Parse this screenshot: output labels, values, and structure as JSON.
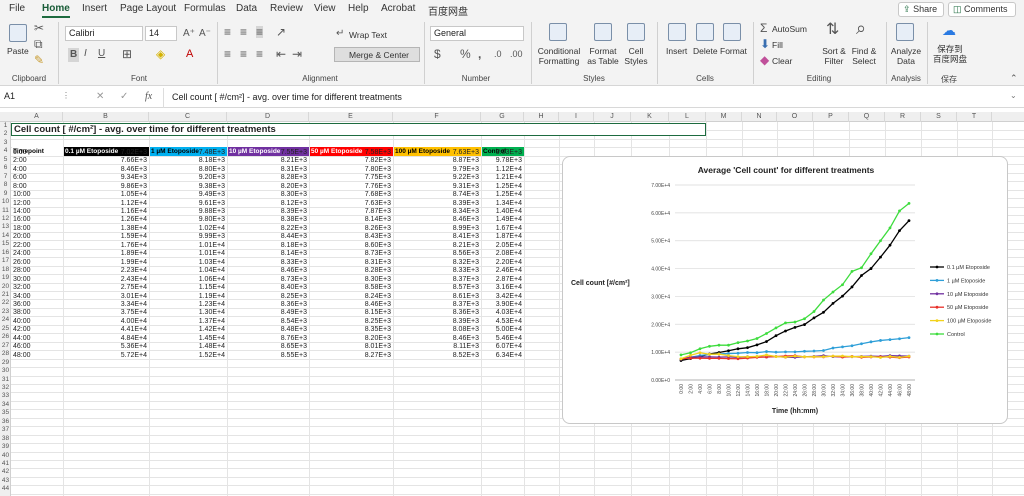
{
  "menu": {
    "tabs": [
      "File",
      "Home",
      "Insert",
      "Page Layout",
      "Formulas",
      "Data",
      "Review",
      "View",
      "Help",
      "Acrobat",
      "百度网盘"
    ],
    "active": "Home",
    "share": "Share",
    "comments": "Comments"
  },
  "ribbon": {
    "clipboard": {
      "paste": "Paste",
      "label": "Clipboard"
    },
    "font": {
      "name": "Calibri",
      "size": "14",
      "label": "Font"
    },
    "alignment": {
      "wrap": "Wrap Text",
      "merge": "Merge & Center",
      "label": "Alignment"
    },
    "number": {
      "format": "General",
      "label": "Number"
    },
    "styles": {
      "conditional": "Conditional Formatting",
      "format_table": "Format as Table",
      "cell_styles": "Cell Styles",
      "label": "Styles"
    },
    "cells": {
      "insert": "Insert",
      "delete": "Delete",
      "format": "Format",
      "label": "Cells"
    },
    "editing": {
      "autosum": "AutoSum",
      "fill": "Fill",
      "clear": "Clear",
      "sort": "Sort & Filter",
      "find": "Find & Select",
      "label": "Editing"
    },
    "analysis": {
      "analyze": "Analyze Data",
      "label": "Analysis"
    },
    "save": {
      "button": "保存到 百度网盘",
      "label": "保存"
    }
  },
  "formula_bar": {
    "name_box": "A1",
    "fx": "fx",
    "content": "Cell count [ #/cm²] - avg. over time for different treatments"
  },
  "columns": [
    "A",
    "B",
    "C",
    "D",
    "E",
    "F",
    "G",
    "H",
    "I",
    "J",
    "K",
    "L",
    "M",
    "N",
    "O",
    "P",
    "Q",
    "R",
    "S",
    "T"
  ],
  "sheet": {
    "title": "Cell count [ #/cm²] - avg. over time for different treatments",
    "headers": [
      "Timepoint",
      "0.1 µM Etoposide",
      "1 µM Etoposide",
      "10 µM Etoposide",
      "50 µM Etoposide",
      "100 µM Etoposide",
      "Control"
    ],
    "header_colors": [
      "#ffffff",
      "#000000",
      "#00b0f0",
      "#7030a0",
      "#ff0000",
      "#ffc000",
      "#00b050"
    ],
    "rows": [
      [
        "0:00",
        "7.02E+3",
        "7.48E+3",
        "7.55E+3",
        "7.58E+3",
        "7.63E+3",
        "9.03E+3"
      ],
      [
        "2:00",
        "7.66E+3",
        "8.18E+3",
        "8.21E+3",
        "7.82E+3",
        "8.87E+3",
        "9.78E+3"
      ],
      [
        "4:00",
        "8.46E+3",
        "8.80E+3",
        "8.31E+3",
        "7.80E+3",
        "9.79E+3",
        "1.12E+4"
      ],
      [
        "6:00",
        "9.34E+3",
        "9.20E+3",
        "8.28E+3",
        "7.75E+3",
        "9.22E+3",
        "1.21E+4"
      ],
      [
        "8:00",
        "9.86E+3",
        "9.38E+3",
        "8.20E+3",
        "7.76E+3",
        "9.31E+3",
        "1.25E+4"
      ],
      [
        "10:00",
        "1.05E+4",
        "9.49E+3",
        "8.30E+3",
        "7.68E+3",
        "8.74E+3",
        "1.25E+4"
      ],
      [
        "12:00",
        "1.12E+4",
        "9.61E+3",
        "8.12E+3",
        "7.63E+3",
        "8.39E+3",
        "1.34E+4"
      ],
      [
        "14:00",
        "1.16E+4",
        "9.88E+3",
        "8.39E+3",
        "7.87E+3",
        "8.34E+3",
        "1.40E+4"
      ],
      [
        "16:00",
        "1.26E+4",
        "9.80E+3",
        "8.38E+3",
        "8.14E+3",
        "8.46E+3",
        "1.49E+4"
      ],
      [
        "18:00",
        "1.38E+4",
        "1.02E+4",
        "8.22E+3",
        "8.26E+3",
        "8.99E+3",
        "1.67E+4"
      ],
      [
        "20:00",
        "1.59E+4",
        "9.99E+3",
        "8.44E+3",
        "8.43E+3",
        "8.41E+3",
        "1.87E+4"
      ],
      [
        "22:00",
        "1.76E+4",
        "1.01E+4",
        "8.18E+3",
        "8.60E+3",
        "8.21E+3",
        "2.05E+4"
      ],
      [
        "24:00",
        "1.89E+4",
        "1.01E+4",
        "8.14E+3",
        "8.73E+3",
        "8.56E+3",
        "2.08E+4"
      ],
      [
        "26:00",
        "1.99E+4",
        "1.03E+4",
        "8.33E+3",
        "8.31E+3",
        "8.32E+3",
        "2.20E+4"
      ],
      [
        "28:00",
        "2.23E+4",
        "1.04E+4",
        "8.46E+3",
        "8.28E+3",
        "8.33E+3",
        "2.46E+4"
      ],
      [
        "30:00",
        "2.43E+4",
        "1.06E+4",
        "8.73E+3",
        "8.30E+3",
        "8.37E+3",
        "2.87E+4"
      ],
      [
        "32:00",
        "2.75E+4",
        "1.15E+4",
        "8.40E+3",
        "8.58E+3",
        "8.57E+3",
        "3.16E+4"
      ],
      [
        "34:00",
        "3.01E+4",
        "1.19E+4",
        "8.25E+3",
        "8.24E+3",
        "8.61E+3",
        "3.42E+4"
      ],
      [
        "36:00",
        "3.34E+4",
        "1.23E+4",
        "8.36E+3",
        "8.46E+3",
        "8.37E+3",
        "3.90E+4"
      ],
      [
        "38:00",
        "3.75E+4",
        "1.30E+4",
        "8.49E+3",
        "8.15E+3",
        "8.36E+3",
        "4.03E+4"
      ],
      [
        "40:00",
        "4.00E+4",
        "1.37E+4",
        "8.54E+3",
        "8.25E+3",
        "8.39E+3",
        "4.53E+4"
      ],
      [
        "42:00",
        "4.41E+4",
        "1.42E+4",
        "8.48E+3",
        "8.35E+3",
        "8.08E+3",
        "5.00E+4"
      ],
      [
        "44:00",
        "4.84E+4",
        "1.45E+4",
        "8.76E+3",
        "8.20E+3",
        "8.46E+3",
        "5.46E+4"
      ],
      [
        "46:00",
        "5.36E+4",
        "1.48E+4",
        "8.65E+3",
        "8.01E+3",
        "8.11E+3",
        "6.07E+4"
      ],
      [
        "48:00",
        "5.72E+4",
        "1.52E+4",
        "8.55E+3",
        "8.27E+3",
        "8.52E+3",
        "6.34E+4"
      ]
    ]
  },
  "chart_data": {
    "type": "line",
    "title": "Average 'Cell count' for different treatments",
    "xlabel": "Time (hh:mm)",
    "ylabel": "Cell count [#/cm²]",
    "ylim": [
      0,
      70000
    ],
    "yticks": [
      "0.00E+0",
      "1.00E+4",
      "2.00E+4",
      "3.00E+4",
      "4.00E+4",
      "5.00E+4",
      "6.00E+4",
      "7.00E+4"
    ],
    "legend_position": "right",
    "categories": [
      "0:00",
      "2:00",
      "4:00",
      "6:00",
      "8:00",
      "10:00",
      "12:00",
      "14:00",
      "16:00",
      "18:00",
      "20:00",
      "22:00",
      "24:00",
      "26:00",
      "28:00",
      "30:00",
      "32:00",
      "34:00",
      "36:00",
      "38:00",
      "40:00",
      "42:00",
      "44:00",
      "46:00",
      "48:00"
    ],
    "series": [
      {
        "name": "0.1 µM Etoposide",
        "color": "#000000",
        "values": [
          7020,
          7660,
          8460,
          9340,
          9860,
          10500,
          11200,
          11600,
          12600,
          13800,
          15900,
          17600,
          18900,
          19900,
          22300,
          24300,
          27500,
          30100,
          33400,
          37500,
          40000,
          44100,
          48400,
          53600,
          57200
        ]
      },
      {
        "name": "1 µM Etoposide",
        "color": "#2e9fd8",
        "values": [
          7480,
          8180,
          8800,
          9200,
          9380,
          9490,
          9610,
          9880,
          9800,
          10200,
          9990,
          10100,
          10100,
          10300,
          10400,
          10600,
          11500,
          11900,
          12300,
          13000,
          13700,
          14200,
          14500,
          14800,
          15200
        ]
      },
      {
        "name": "10 µM Etoposide",
        "color": "#7030a0",
        "values": [
          7550,
          8210,
          8310,
          8280,
          8200,
          8300,
          8120,
          8390,
          8380,
          8220,
          8440,
          8180,
          8140,
          8330,
          8460,
          8730,
          8400,
          8250,
          8360,
          8490,
          8540,
          8480,
          8760,
          8650,
          8550
        ]
      },
      {
        "name": "50 µM Etoposide",
        "color": "#e8302a",
        "values": [
          7580,
          7820,
          7800,
          7750,
          7760,
          7680,
          7630,
          7870,
          8140,
          8260,
          8430,
          8600,
          8730,
          8310,
          8280,
          8300,
          8580,
          8240,
          8460,
          8150,
          8250,
          8350,
          8200,
          8010,
          8270
        ]
      },
      {
        "name": "100 µM Etoposide",
        "color": "#f2d21b",
        "values": [
          7630,
          8870,
          9790,
          9220,
          9310,
          8740,
          8390,
          8340,
          8460,
          8990,
          8410,
          8210,
          8560,
          8320,
          8330,
          8370,
          8570,
          8610,
          8370,
          8360,
          8390,
          8080,
          8460,
          8110,
          8520
        ]
      },
      {
        "name": "Control",
        "color": "#3ddc3d",
        "values": [
          9030,
          9780,
          11200,
          12100,
          12500,
          12500,
          13400,
          14000,
          14900,
          16700,
          18700,
          20500,
          20800,
          22000,
          24600,
          28700,
          31600,
          34200,
          39000,
          40300,
          45300,
          50000,
          54600,
          60700,
          63400
        ]
      }
    ]
  }
}
